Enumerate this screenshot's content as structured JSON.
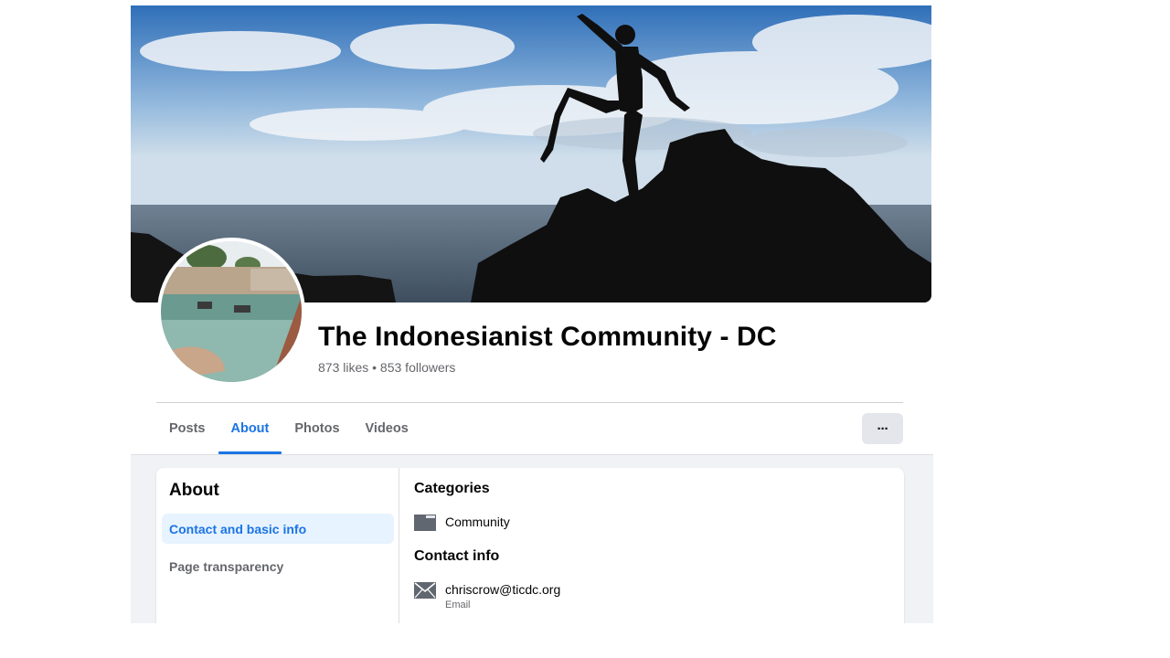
{
  "profile": {
    "name": "The Indonesianist Community - DC",
    "stats": "873 likes • 853 followers"
  },
  "tabs": [
    {
      "label": "Posts",
      "active": false
    },
    {
      "label": "About",
      "active": true
    },
    {
      "label": "Photos",
      "active": false
    },
    {
      "label": "Videos",
      "active": false
    }
  ],
  "more_button": {
    "label": "···",
    "icon": "more-horizontal-icon"
  },
  "about": {
    "heading": "About",
    "nav": [
      {
        "label": "Contact and basic info",
        "active": true
      },
      {
        "label": "Page transparency",
        "active": false
      }
    ]
  },
  "details": {
    "categories_title": "Categories",
    "category": {
      "label": "Community",
      "icon": "folder-icon"
    },
    "contact_title": "Contact info",
    "email": {
      "value": "chriscrow@ticdc.org",
      "sublabel": "Email",
      "icon": "envelope-icon"
    }
  },
  "colors": {
    "accent": "#1b74e4",
    "accent_bg": "#e7f3ff",
    "secondary_text": "#65676b",
    "button_bg": "#e4e6eb",
    "page_bg": "#f0f2f5"
  }
}
